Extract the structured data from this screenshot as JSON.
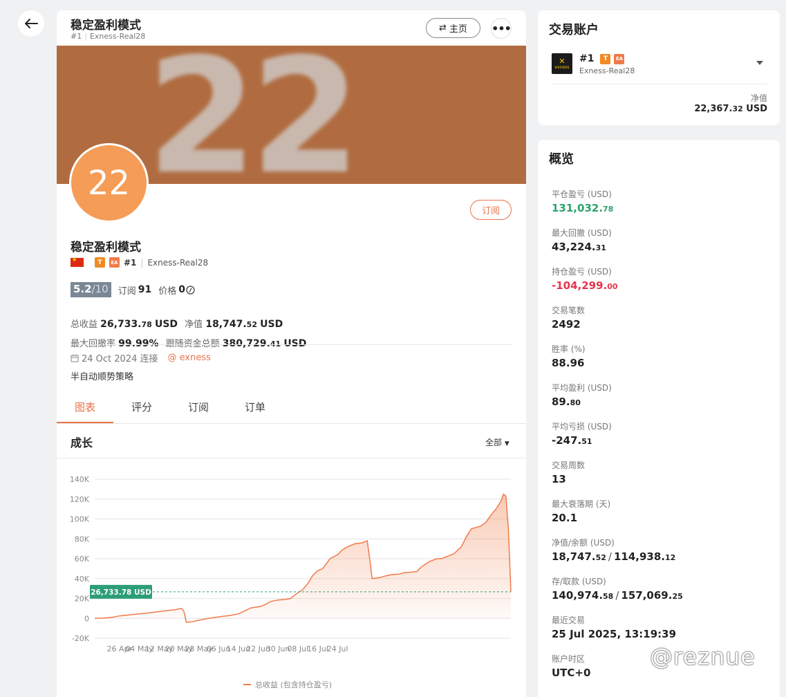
{
  "header": {
    "title": "稳定盈利模式",
    "rank": "#1",
    "account": "Exness-Real28",
    "home_label": "主页",
    "more_label": "•••"
  },
  "banner": {
    "text": "22"
  },
  "profile": {
    "avatar_text": "22",
    "subscribe_label": "订阅",
    "name": "稳定盈利模式",
    "badge_t": "T",
    "badge_ea": "EA",
    "rank": "#1",
    "account": "Exness-Real28",
    "rating": "5.2",
    "rating_out": "/10",
    "subs_label": "订阅",
    "subs_value": "91",
    "price_label": "价格",
    "price_value": "0",
    "total_profit_label": "总收益",
    "total_profit_int": "26,733.",
    "total_profit_dec": "78",
    "equity_label": "净值",
    "equity_int": "18,747.",
    "equity_dec": "52",
    "usd": "USD",
    "max_dd_label": "最大回撤率",
    "max_dd_value": "99.99%",
    "follow_label": "跟随资金总额",
    "follow_int": "380,729.",
    "follow_dec": "41",
    "connect_date": "24 Oct 2024 连接",
    "broker": "@ exness",
    "description": "半自动顺势策略"
  },
  "tabs": [
    {
      "label": "图表",
      "active": true
    },
    {
      "label": "评分",
      "active": false
    },
    {
      "label": "订阅",
      "active": false
    },
    {
      "label": "订单",
      "active": false
    }
  ],
  "chart_section": {
    "title": "成长",
    "filter": "全部"
  },
  "chart_data": {
    "type": "area",
    "series": [
      {
        "name": "总收益 (包含持仓盈亏)",
        "color": "#f07a4a",
        "points": [
          [
            0,
            0
          ],
          [
            3,
            200
          ],
          [
            7,
            1000
          ],
          [
            10,
            2500
          ],
          [
            14,
            3500
          ],
          [
            18,
            4500
          ],
          [
            22,
            5500
          ],
          [
            25,
            6500
          ],
          [
            28,
            7500
          ],
          [
            32,
            8500
          ],
          [
            35,
            10000
          ],
          [
            36,
            7000
          ],
          [
            37,
            -4000
          ],
          [
            39,
            -3500
          ],
          [
            42,
            -2000
          ],
          [
            46,
            0
          ],
          [
            50,
            1500
          ],
          [
            55,
            3000
          ],
          [
            58,
            4500
          ],
          [
            61,
            8000
          ],
          [
            63,
            10500
          ],
          [
            67,
            12000
          ],
          [
            69,
            14000
          ],
          [
            71,
            17000
          ],
          [
            74,
            18500
          ],
          [
            77,
            19000
          ],
          [
            79,
            20000
          ],
          [
            81,
            24000
          ],
          [
            84,
            29000
          ],
          [
            86,
            35000
          ],
          [
            88,
            43000
          ],
          [
            90,
            48000
          ],
          [
            92,
            50000
          ],
          [
            95,
            60000
          ],
          [
            98,
            64000
          ],
          [
            100,
            69000
          ],
          [
            102,
            72000
          ],
          [
            105,
            75000
          ],
          [
            108,
            76000
          ],
          [
            110,
            78000
          ],
          [
            111,
            60000
          ],
          [
            112,
            40000
          ],
          [
            115,
            41000
          ],
          [
            118,
            43000
          ],
          [
            120,
            44000
          ],
          [
            123,
            44500
          ],
          [
            125,
            46000
          ],
          [
            128,
            46500
          ],
          [
            130,
            47000
          ],
          [
            132,
            52000
          ],
          [
            135,
            57000
          ],
          [
            138,
            60000
          ],
          [
            140,
            60000
          ],
          [
            142,
            62000
          ],
          [
            145,
            65000
          ],
          [
            148,
            72000
          ],
          [
            150,
            82000
          ],
          [
            152,
            90000
          ],
          [
            154,
            91500
          ],
          [
            156,
            93000
          ],
          [
            158,
            97000
          ],
          [
            160,
            104000
          ],
          [
            162,
            110000
          ],
          [
            164,
            118000
          ],
          [
            165,
            125000
          ],
          [
            166,
            123000
          ],
          [
            167,
            90000
          ],
          [
            168,
            26733
          ]
        ]
      }
    ],
    "x_tick_labels": [
      "26 Apr",
      "04 May",
      "12 May",
      "20 May",
      "28 May",
      "06 Jun",
      "14 Jun",
      "22 Jun",
      "30 Jun",
      "08 Jul",
      "16 Jul",
      "24 Jul"
    ],
    "x_tick_pos": [
      10,
      18,
      26,
      34,
      42,
      50,
      58,
      66,
      74,
      82,
      90,
      98
    ],
    "y_ticks": [
      140000,
      120000,
      100000,
      80000,
      60000,
      40000,
      20000,
      0,
      -20000
    ],
    "y_tick_labels": [
      "140K",
      "120K",
      "100K",
      "80K",
      "60K",
      "40K",
      "20K",
      "0",
      "-20K"
    ],
    "ylim": [
      -20000,
      140000
    ],
    "xlim": [
      0,
      168
    ],
    "current_value": 26733.78,
    "current_label": "26,733.78 USD",
    "legend": "总收益 (包含持仓盈亏)",
    "grid": true
  },
  "account_card": {
    "title": "交易账户",
    "rank": "#1",
    "badge_t": "T",
    "badge_ea": "EA",
    "name": "Exness-Real28",
    "logo_text": "exness",
    "equity_label": "净值",
    "equity_int": "22,367.",
    "equity_dec": "32",
    "usd": "USD"
  },
  "overview": {
    "title": "概览",
    "closed_pl_label": "平仓盈亏 (USD)",
    "closed_pl_int": "131,032.",
    "closed_pl_dec": "78",
    "max_dd_label": "最大回撤 (USD)",
    "max_dd_int": "43,224.",
    "max_dd_dec": "31",
    "open_pl_label": "持仓盈亏 (USD)",
    "open_pl_int": "-104,299.",
    "open_pl_dec": "00",
    "trades_label": "交易笔数",
    "trades": "2492",
    "winrate_label": "胜率 (%)",
    "winrate": "88.96",
    "avg_win_label": "平均盈利 (USD)",
    "avg_win_int": "89.",
    "avg_win_dec": "80",
    "avg_loss_label": "平均亏损 (USD)",
    "avg_loss_int": "-247.",
    "avg_loss_dec": "51",
    "weeks_label": "交易周数",
    "weeks": "13",
    "max_decline_label": "最大衰落期 (天)",
    "max_decline": "20.1",
    "eq_bal_label": "净值/余额 (USD)",
    "eq_int": "18,747.",
    "eq_dec": "52",
    "bal_int": "114,938.",
    "bal_dec": "12",
    "dep_wd_label": "存/取款 (USD)",
    "dep_int": "140,974.",
    "dep_dec": "58",
    "wd_int": "157,069.",
    "wd_dec": "25",
    "last_trade_label": "最近交易",
    "last_trade": "25 Jul 2025, 13:19:39",
    "tz_label": "账户时区",
    "tz": "UTC+0"
  },
  "watermark": "@reznue"
}
